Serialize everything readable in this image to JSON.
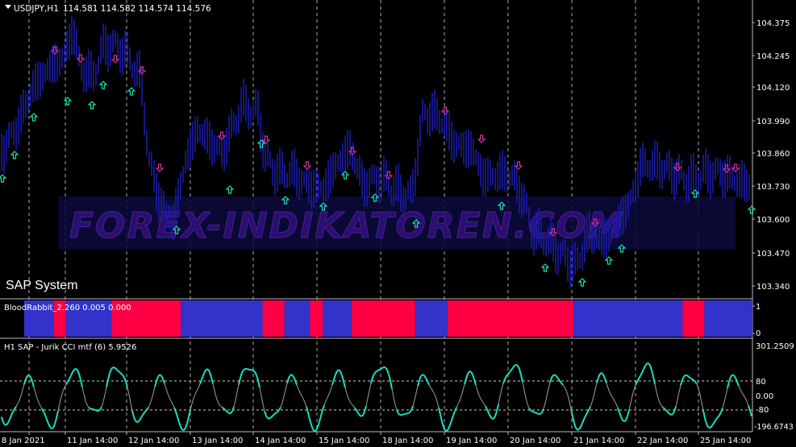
{
  "header": {
    "symbol_title": "USDJPY,H1",
    "ohlc": "114.581 114.582 114.574 114.576",
    "menu_icon": "triangle-down-icon"
  },
  "main_panel": {
    "system_label": "SAP System",
    "watermark": "FOREX-INDIKATOREN.COM",
    "price_ticks": [
      "104.375",
      "104.245",
      "104.120",
      "103.990",
      "103.860",
      "103.730",
      "103.600",
      "103.470",
      "103.340"
    ]
  },
  "blood_panel": {
    "label": "BloodRabbit_2.260 0.005 0.000",
    "ticks": [
      "1",
      "0"
    ],
    "segments": [
      {
        "color": "blue",
        "from": 0,
        "to": 37
      },
      {
        "color": "red",
        "from": 37,
        "to": 52
      },
      {
        "color": "blue",
        "from": 52,
        "to": 109
      },
      {
        "color": "red",
        "from": 109,
        "to": 195
      },
      {
        "color": "blue",
        "from": 195,
        "to": 297
      },
      {
        "color": "red",
        "from": 297,
        "to": 324
      },
      {
        "color": "blue",
        "from": 324,
        "to": 356
      },
      {
        "color": "red",
        "from": 356,
        "to": 372
      },
      {
        "color": "blue",
        "from": 372,
        "to": 408
      },
      {
        "color": "red",
        "from": 408,
        "to": 487
      },
      {
        "color": "blue",
        "from": 487,
        "to": 527
      },
      {
        "color": "red",
        "from": 527,
        "to": 684
      },
      {
        "color": "blue",
        "from": 684,
        "to": 820
      },
      {
        "color": "red",
        "from": 820,
        "to": 847
      },
      {
        "color": "blue",
        "from": 847,
        "to": 907
      }
    ]
  },
  "cci_panel": {
    "label": "H1 SAP - Jurik CCI mtf (6) 5.9526",
    "ticks": [
      "301.2509",
      "80",
      "0.00",
      "-80",
      "-196.6743"
    ],
    "levels": [
      80,
      -80
    ]
  },
  "time_axis": {
    "labels": [
      "8 Jan 2021",
      "11 Jan 14:00",
      "12 Jan 14:00",
      "13 Jan 14:00",
      "14 Jan 14:00",
      "15 Jan 14:00",
      "18 Jan 14:00",
      "19 Jan 14:00",
      "20 Jan 14:00",
      "21 Jan 14:00",
      "22 Jan 14:00",
      "25 Jan 14:00"
    ]
  },
  "colors": {
    "candles": "#1c1ca8",
    "up_arrow": "#19e0b0",
    "down_arrow": "#d2309a",
    "blue_band": "#3333cc",
    "red_band": "#ff0045",
    "cci_up": "#19e0c0",
    "cci_mid": "#a0a0a0",
    "grid": "#d8d8d8"
  }
}
